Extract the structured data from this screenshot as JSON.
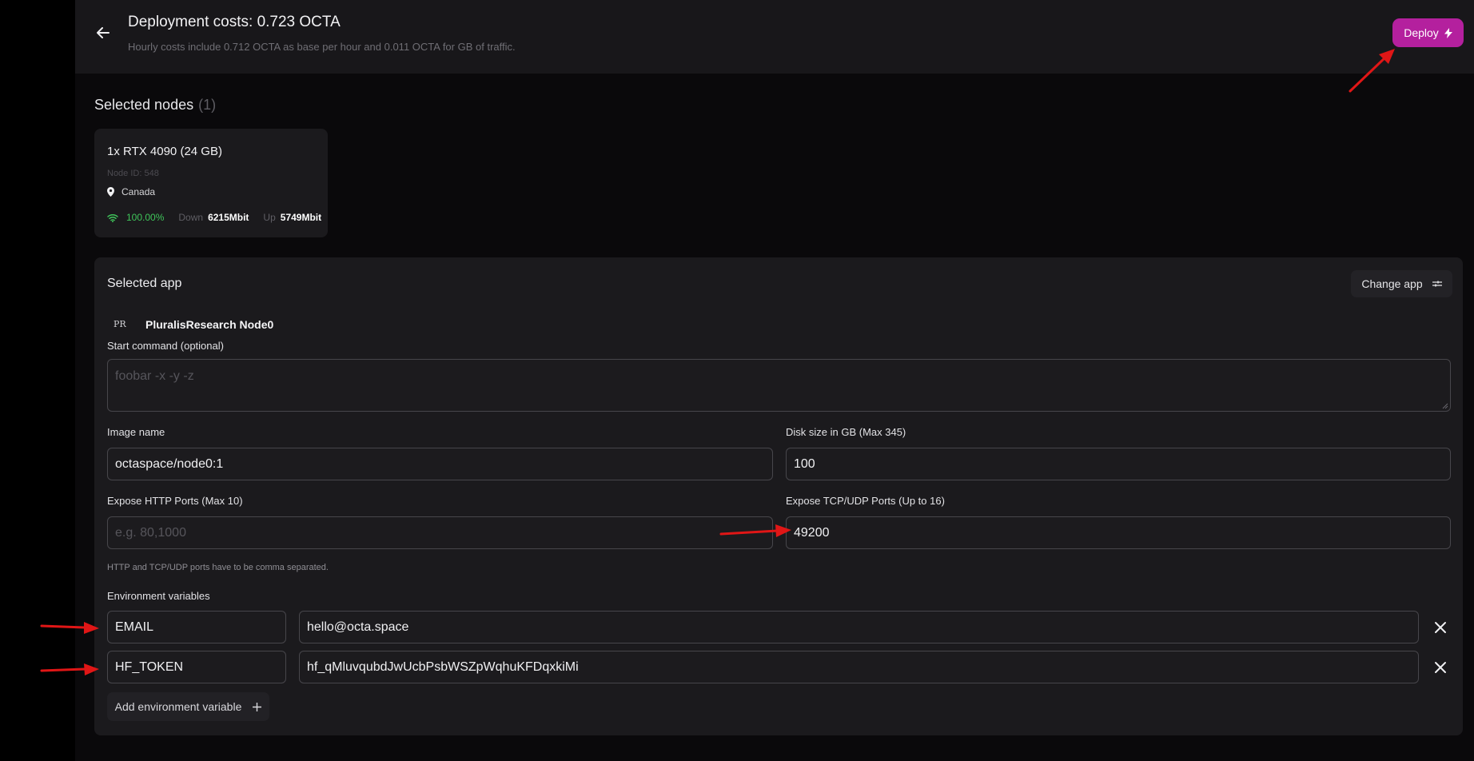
{
  "header": {
    "title": "Deployment costs: 0.723 OCTA",
    "subtitle": "Hourly costs include 0.712 OCTA as base per hour and 0.011 OCTA for GB of traffic.",
    "deploy_label": "Deploy"
  },
  "nodes": {
    "title": "Selected nodes",
    "count": "(1)",
    "card": {
      "name": "1x RTX 4090 (24 GB)",
      "node_id": "Node ID: 548",
      "location": "Canada",
      "uptime": "100.00%",
      "down_label": "Down",
      "down_value": "6215Mbit",
      "up_label": "Up",
      "up_value": "5749Mbit"
    }
  },
  "app": {
    "title": "Selected app",
    "change_label": "Change app",
    "logo_text": "PR",
    "name": "PluralisResearch Node0",
    "start_command_label": "Start command (optional)",
    "start_command_placeholder": "foobar -x -y -z",
    "image_name_label": "Image name",
    "image_name_value": "octaspace/node0:1",
    "disk_label": "Disk size in GB (Max 345)",
    "disk_value": "100",
    "http_ports_label": "Expose HTTP Ports (Max 10)",
    "http_ports_placeholder": "e.g. 80,1000",
    "tcp_ports_label": "Expose TCP/UDP Ports (Up to 16)",
    "tcp_ports_value": "49200",
    "ports_hint": "HTTP and TCP/UDP ports have to be comma separated.",
    "env_label": "Environment variables",
    "env": [
      {
        "key": "EMAIL",
        "value": "hello@octa.space"
      },
      {
        "key": "HF_TOKEN",
        "value": "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"
      }
    ],
    "add_env_label": "Add environment variable"
  },
  "colors": {
    "accent": "#b4209e",
    "annotation_arrow": "#e01616",
    "uptime_green": "#3fc45a"
  }
}
